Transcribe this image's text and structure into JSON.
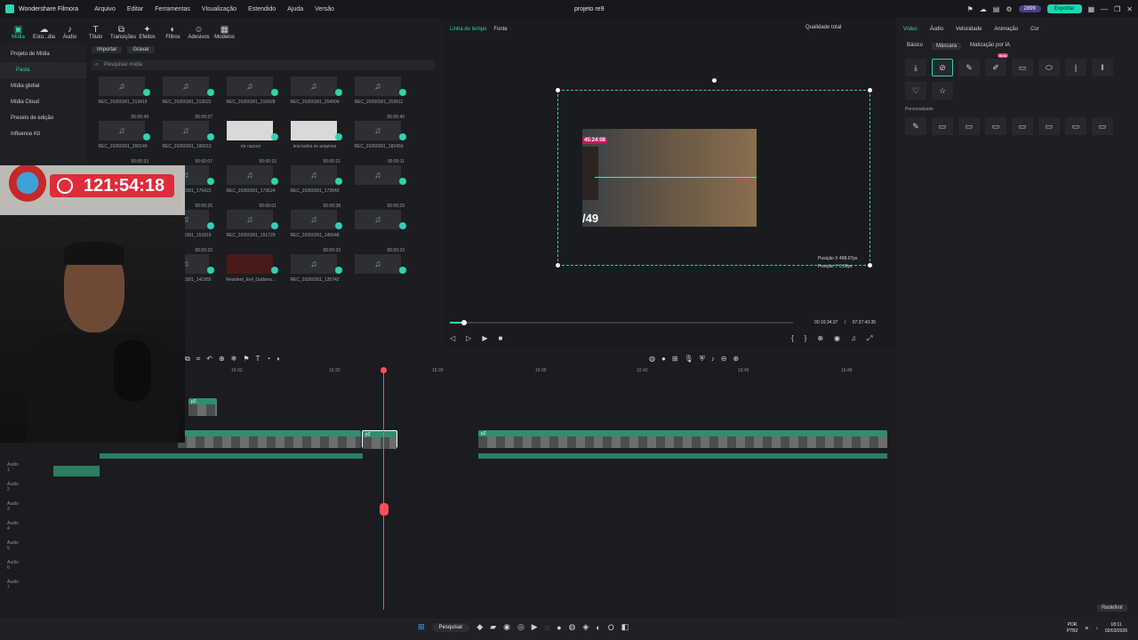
{
  "titlebar": {
    "app_name": "Wondershare Filmora",
    "menu": [
      "Arquivo",
      "Editar",
      "Ferramentas",
      "Visualização",
      "Estendido",
      "Ajuda",
      "Versão"
    ],
    "project_title": "projeto re9",
    "credits": "2899",
    "export_label": "Exportar"
  },
  "toolbar": [
    {
      "label": "Mídia",
      "icon": "▣"
    },
    {
      "label": "Esto...dia",
      "icon": "☁"
    },
    {
      "label": "Áudio",
      "icon": "♪"
    },
    {
      "label": "Título",
      "icon": "T"
    },
    {
      "label": "Transições",
      "icon": "⧉"
    },
    {
      "label": "Efeitos",
      "icon": "✦"
    },
    {
      "label": "Filtros",
      "icon": "◐"
    },
    {
      "label": "Adesivos",
      "icon": "☺"
    },
    {
      "label": "Modelos",
      "icon": "▦"
    }
  ],
  "sidebar": {
    "items": [
      "Projeto de Mídia",
      "Pasta",
      "Mídia global",
      "Mídia Cloud",
      "Presets de edição",
      "Influence Kit"
    ]
  },
  "media": {
    "import_label": "Importar",
    "record_label": "Gravar",
    "search_placeholder": "Pesquisar mídia",
    "items": [
      {
        "name": "REC_20260301_213416",
        "dur": "",
        "type": "audio"
      },
      {
        "name": "REC_20260301_213022",
        "dur": "",
        "type": "audio"
      },
      {
        "name": "REC_20260301_210928",
        "dur": "",
        "type": "audio"
      },
      {
        "name": "REC_20260301_204904",
        "dur": "",
        "type": "audio"
      },
      {
        "name": "REC_20260301_203611",
        "dur": "",
        "type": "audio"
      },
      {
        "name": "REC_20260301_200149",
        "dur": "00:00:49",
        "type": "audio"
      },
      {
        "name": "REC_20260301_190010",
        "dur": "00:00:37",
        "type": "audio"
      },
      {
        "name": "mr raccon",
        "dur": "",
        "type": "photo"
      },
      {
        "name": "leia todos os arquivos",
        "dur": "",
        "type": "photo"
      },
      {
        "name": "REC_20260301_182459",
        "dur": "00:00:40",
        "type": "audio"
      },
      {
        "name": "REC_20260301_180117",
        "dur": "00:00:33",
        "type": "audio"
      },
      {
        "name": "REC_20260301_175422",
        "dur": "00:00:07",
        "type": "audio"
      },
      {
        "name": "REC_20260301_173624",
        "dur": "00:00:15",
        "type": "audio"
      },
      {
        "name": "REC_20260301_172840",
        "dur": "00:00:21",
        "type": "audio"
      },
      {
        "name": "",
        "dur": "00:00:11",
        "type": "audio"
      },
      {
        "name": "REC_20260301_153905",
        "dur": "00:00:09",
        "type": "audio"
      },
      {
        "name": "REC_20260301_151819",
        "dur": "00:00:26",
        "type": "audio"
      },
      {
        "name": "REC_20260301_151729",
        "dur": "00:00:01",
        "type": "audio"
      },
      {
        "name": "REC_20260301_145048",
        "dur": "00:00:38",
        "type": "audio"
      },
      {
        "name": "",
        "dur": "00:00:29",
        "type": "audio"
      },
      {
        "name": "REC_20260301_143235",
        "dur": "00:00:08",
        "type": "audio"
      },
      {
        "name": "REC_20260301_141955",
        "dur": "00:00:22",
        "type": "audio"
      },
      {
        "name": "Resident_Evil_Outbrea...",
        "dur": "",
        "type": "red"
      },
      {
        "name": "REC_20260301_135742",
        "dur": "00:00:33",
        "type": "audio"
      },
      {
        "name": "",
        "dur": "00:00:23",
        "type": "audio"
      }
    ]
  },
  "preview": {
    "tab_timeline": "Linha do tempo",
    "tab_source": "Fonte",
    "quality": "Qualidade total",
    "video_timestamp": "45:24:08",
    "video_overlay_text": "/49",
    "pos_x": "Posição X 498.07px",
    "pos_y": "Posição Y 0.00px",
    "current_time": "00:16:34:37",
    "separator": "/",
    "total_time": "07:37:43:35",
    "progress": 0.04
  },
  "properties": {
    "tabs": [
      "Vídeo",
      "Áudio",
      "Velocidade",
      "Animação",
      "Cor"
    ],
    "subtabs": [
      "Básico",
      "Máscara",
      "Matização por IA"
    ],
    "beta_label": "Beta",
    "custom_label": "Personalizado",
    "reset_label": "Redefinir"
  },
  "timeline": {
    "ruler": [
      "16:33",
      "16:33",
      "16:30",
      "16:39",
      "16:42",
      "16:45",
      "16:48"
    ],
    "clip_label": "p2",
    "track_labels": [
      "Áudio 1",
      "Áudio 2",
      "Áudio 3",
      "Áudio 4",
      "Áudio 5",
      "Áudio 6",
      "Áudio 7"
    ]
  },
  "overlay": {
    "timer": "121:54:18"
  },
  "taskbar": {
    "search_label": "Pesquisar",
    "lang": "POR",
    "layout": "PTB2",
    "time": "18:11",
    "date": "02/03/2026"
  },
  "colors": {
    "accent": "#2fd3b0",
    "playhead": "#ff4d5e",
    "timer_bg": "#e02b3a"
  }
}
